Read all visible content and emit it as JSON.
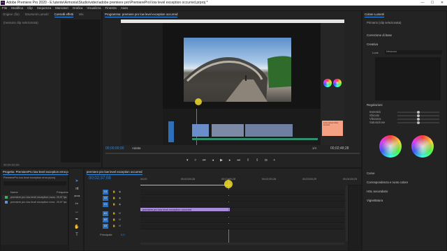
{
  "window": {
    "title": "Adobe Premiere Pro 2020 - E:\\utente\\Armonia\\Studio\\video\\adobe premiere pro\\PremiereProl low level exception occurred.prproj *",
    "logo_text": "Pr",
    "controls": [
      "—",
      "☐",
      "✕"
    ]
  },
  "menu": [
    "File",
    "Modifica",
    "Clip",
    "Sequenza",
    "Marcatori",
    "Grafica",
    "Visualizza",
    "Finestra",
    "Aiuto"
  ],
  "source_panel": {
    "tabs": [
      "Origine: (fin)",
      "Strumenti Lumetri",
      "Controlli effetti",
      "Mix"
    ],
    "active_tab": 2,
    "message": "(nessuna clip selezionata)",
    "timecode": "00;00;00;00"
  },
  "program_monitor": {
    "tab": "Programma: premiere pro low level exception occurred",
    "timecode_left": "00;00;00;00",
    "fit": "Adatta",
    "scale": "1/4",
    "timecode_right": "00;02;48;28"
  },
  "lumetri": {
    "tab": "Colore Lumetri",
    "master": "Primario (clip selezionata)",
    "sections": [
      "Correzione di base",
      "Creativa",
      "Regolazioni",
      "Curve",
      "Correspondenza e ruoto colore",
      "HSL secondario",
      "Vignettatura"
    ],
    "look_label": "Look",
    "look_value": "Nessuno",
    "slider_labels": [
      "Intensità",
      "Sfocato",
      "Vibranza",
      "Saturazione",
      "Tinta ombre",
      "Tinta alte luci",
      "Bilanciamento tinta"
    ]
  },
  "project_panel": {
    "tab": "Progetto: PremierePro low level exception error.prproj",
    "breadcrumb": "PremierePro low level exception error.prproj",
    "columns": [
      "Nome",
      "Frequenza"
    ],
    "items": [
      {
        "name": "premiere pro low level exception occurred",
        "rate": "29,97 fps"
      },
      {
        "name": "premiere pro low level exception error.mp4",
        "rate": "29,97 fps"
      }
    ]
  },
  "timeline": {
    "tab": "premiere pro low level exception occurred",
    "timecode": "00;02;37;08",
    "ruler": [
      "00;00",
      "00;00;59;28",
      "00;01;59;28",
      "00;02;59;28",
      "00;03;59;29",
      "00;04;59;29"
    ],
    "video_tracks": [
      "V3",
      "V2",
      "V1"
    ],
    "audio_tracks": [
      "A1",
      "A2",
      "A3"
    ],
    "master_label": "Principale",
    "master_value": "0,0",
    "clip_label": "premiere pro low level exception occurred",
    "playhead_fraction": 0.43,
    "clip_end_fraction": 0.44
  },
  "tools": [
    "selection-tool",
    "track-select-tool",
    "ripple-edit-tool",
    "razor-tool",
    "slip-tool",
    "pen-tool",
    "hand-tool",
    "type-tool"
  ],
  "inner_screenshot": {
    "note_lines": [
      "Lorem ipsum dolor",
      "sit amet"
    ]
  },
  "colors": {
    "accent": "#2d8ceb",
    "clip": "#a78bd6",
    "highlight": "#f0dc28",
    "note": "#f6a184"
  }
}
